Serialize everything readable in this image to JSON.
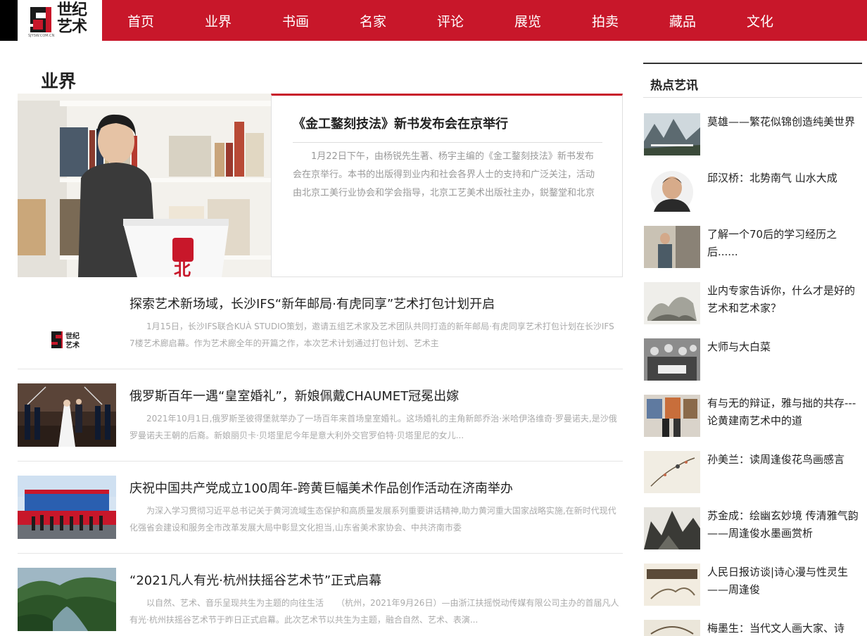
{
  "brand": {
    "logo_text": "世纪\n艺术",
    "logo_sub": "SJYSW.COM.CN"
  },
  "nav": [
    "首页",
    "业界",
    "书画",
    "名家",
    "评论",
    "展览",
    "拍卖",
    "藏品",
    "文化"
  ],
  "section": {
    "title": "业界"
  },
  "featured": {
    "title": "《金工鍪刻技法》新书发布会在京举行",
    "desc": "1月22日下午，由杨锐先生著、杨宇主编的《金工鍪刻技法》新书发布会在京举行。本书的出版得到业内和社会各界人士的支持和广泛关注，活动由北京工美行业协会和学会指导，北京工艺美术出版社主办，鋭鍪堂和北京"
  },
  "news": [
    {
      "title": "探索艺术新场域，长沙IFS“新年邮局·有虎同享”艺术打包计划开启",
      "desc": "1月15日，长沙IFS联合KUÀ STUDIO策划，邀请五组艺术家及艺术团队共同打造的新年邮局·有虎同享艺术打包计划在长沙IFS 7楼艺术廊启幕。作为艺术廊全年的开篇之作，本次艺术计划通过打包计划、艺术主"
    },
    {
      "title": "俄罗斯百年一遇“皇室婚礼”，新娘佩戴CHAUMET冠冕出嫁",
      "desc": "2021年10月1日,俄罗斯圣彼得堡就举办了一场百年来首场皇室婚礼。这场婚礼的主角新郎乔治·米哈伊洛维奇·罗曼诺夫,是沙俄罗曼诺夫王朝的后裔。新娘丽贝卡·贝塔里尼今年是意大利外交官罗伯特·贝塔里尼的女儿..."
    },
    {
      "title": "庆祝中国共产党成立100周年-跨黄巨幅美术作品创作活动在济南举办",
      "desc": "为深入学习贯彻习近平总书记关于黄河流域生态保护和高质量发展系列重要讲话精神,助力黄河重大国家战略实施,在新时代现代化强省会建设和服务全市改革发展大局中彰显文化担当,山东省美术家协会、中共济南市委"
    },
    {
      "title": "“2021凡人有光·杭州扶摇谷艺术节”正式启幕",
      "desc": "以自然、艺术、音乐呈现共生为主题的向往生活　　（杭州，2021年9月26日）—由浙江扶摇悦动传媒有限公司主办的首届凡人有光·杭州扶摇谷艺术节于昨日正式启幕。此次艺术节以共生为主题，融合自然、艺术、表演..."
    }
  ],
  "sidebar": {
    "title": "热点艺讯",
    "items": [
      "莫雄——繁花似锦创造纯美世界",
      "邱汉桥：北势南气 山水大成",
      "了解一个70后的学习经历之后......",
      "业内专家告诉你，什么才是好的艺术和艺术家？",
      "大师与大白菜",
      "有与无的辩证，雅与拙的共存---论黄建南艺术中的道",
      "孙美兰：读周逢俊花鸟画感言",
      "苏金成：绘幽玄妙境 传清雅气韵——周逢俊水墨画赏析",
      "人民日报访谈|诗心漫与性灵生——周逢俊",
      "梅墨生：当代文人画大家、诗"
    ]
  },
  "colors": {
    "accent": "#c8172a",
    "text": "#222222",
    "muted": "#aaaaaa"
  }
}
